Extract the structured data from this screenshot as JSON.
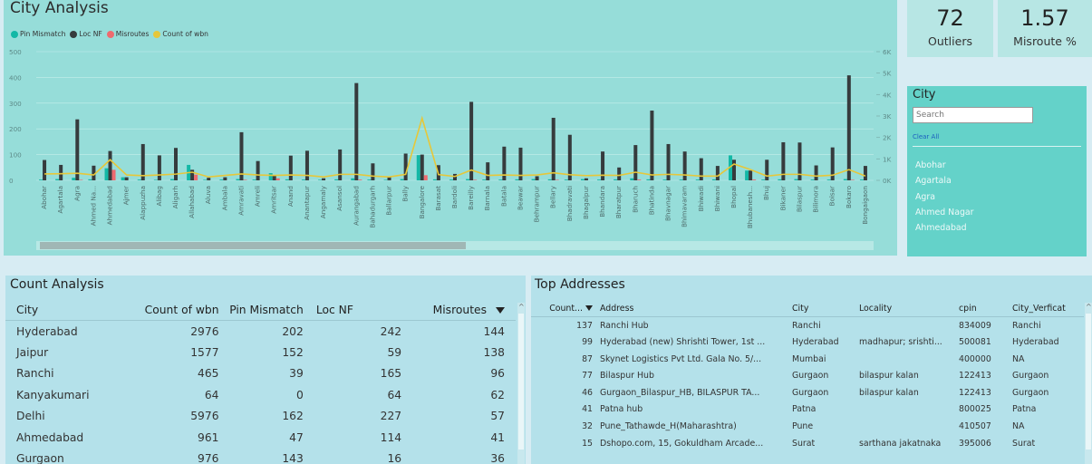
{
  "chart_panel": {
    "title": "City Analysis"
  },
  "kpis": {
    "outliers": {
      "value": "72",
      "label": "Outliers"
    },
    "misroute": {
      "value": "1.57",
      "label": "Misroute %"
    }
  },
  "slicer": {
    "title": "City",
    "search_placeholder": "Search",
    "clear_label": "Clear All",
    "items": [
      "Abohar",
      "Agartala",
      "Agra",
      "Ahmed Nagar",
      "Ahmedabad"
    ]
  },
  "count_analysis": {
    "title": "Count Analysis",
    "columns": [
      "City",
      "Count of wbn",
      "Pin Mismatch",
      "Loc NF",
      "Misroutes"
    ],
    "rows": [
      [
        "Hyderabad",
        "2976",
        "202",
        "242",
        "144"
      ],
      [
        "Jaipur",
        "1577",
        "152",
        "59",
        "138"
      ],
      [
        "Ranchi",
        "465",
        "39",
        "165",
        "96"
      ],
      [
        "Kanyakumari",
        "64",
        "0",
        "64",
        "62"
      ],
      [
        "Delhi",
        "5976",
        "162",
        "227",
        "57"
      ],
      [
        "Ahmedabad",
        "961",
        "47",
        "114",
        "41"
      ],
      [
        "Gurgaon",
        "976",
        "143",
        "16",
        "36"
      ]
    ]
  },
  "top_addresses": {
    "title": "Top Addresses",
    "columns": [
      "Count...",
      "Address",
      "City",
      "Locality",
      "cpin",
      "City_Verficat"
    ],
    "rows": [
      [
        "137",
        "Ranchi Hub",
        "Ranchi",
        "",
        "834009",
        "Ranchi"
      ],
      [
        "99",
        "Hyderabad (new) Shrishti Tower, 1st ...",
        "Hyderabad",
        "madhapur; srishti...",
        "500081",
        "Hyderabad"
      ],
      [
        "87",
        "Skynet Logistics Pvt Ltd. Gala No. 5/...",
        "Mumbai",
        "",
        "400000",
        "NA"
      ],
      [
        "77",
        "Bilaspur Hub",
        "Gurgaon",
        "bilaspur kalan",
        "122413",
        "Gurgaon"
      ],
      [
        "46",
        "Gurgaon_Bilaspur_HB, BILASPUR TA...",
        "Gurgaon",
        "bilaspur kalan",
        "122413",
        "Gurgaon"
      ],
      [
        "41",
        "Patna  hub",
        "Patna",
        "",
        "800025",
        "Patna"
      ],
      [
        "32",
        "Pune_Tathawde_H(Maharashtra)",
        "Pune",
        "",
        "410507",
        "NA"
      ],
      [
        "15",
        "Dshopo.com, 15, Gokuldham Arcade...",
        "Surat",
        "sarthana jakatnaka",
        "395006",
        "Surat"
      ]
    ]
  },
  "colors": {
    "pin_mismatch": "#13b8a6",
    "loc_nf": "#363b3d",
    "misroutes": "#ee6a6f",
    "count_of_wbn": "#e6c73a",
    "chart_bg": "#96ddd9"
  },
  "chart_data": {
    "type": "bar",
    "title": "City Analysis",
    "legend_position": "top-left",
    "y_left": {
      "ticks": [
        "0",
        "100",
        "200",
        "300",
        "400",
        "500"
      ],
      "range": [
        0,
        500
      ]
    },
    "y_right": {
      "ticks": [
        "0K",
        "1K",
        "2K",
        "3K",
        "4K",
        "5K",
        "6K"
      ],
      "range": [
        0,
        6000
      ]
    },
    "categories": [
      "Abohar",
      "Agartala",
      "Agra",
      "Ahmed Na...",
      "Ahmedabad",
      "Ajmer",
      "Alappuzha",
      "Alibag",
      "Aligarh",
      "Allahabad",
      "Aluva",
      "Ambala",
      "Amravati",
      "Amreli",
      "Amritsar",
      "Anand",
      "Anantapur",
      "Angamaly",
      "Asansol",
      "Aurangabad",
      "Bahadurgarh",
      "Ballarpur",
      "Bally",
      "Bangalore",
      "Barasat",
      "Bardoli",
      "Bareilly",
      "Barnala",
      "Batala",
      "Beawar",
      "Behrampur",
      "Bellary",
      "Bhadravati",
      "Bhagalpur",
      "Bhandara",
      "Bharatpur",
      "Bharuch",
      "Bhatinda",
      "Bhavnagar",
      "Bhimavaram",
      "Bhiwadi",
      "Bhiwani",
      "Bhopal",
      "Bhubanesh...",
      "Bhuj",
      "Bikaner",
      "Bilaspur",
      "Bilimora",
      "Boisar",
      "Bokaro",
      "Bongaigaon"
    ],
    "series": [
      {
        "name": "Pin Mismatch",
        "axis": "left",
        "values": [
          3,
          5,
          10,
          4,
          47,
          12,
          3,
          2,
          5,
          60,
          2,
          3,
          5,
          3,
          28,
          4,
          3,
          2,
          4,
          8,
          3,
          2,
          5,
          98,
          4,
          3,
          5,
          3,
          3,
          4,
          5,
          4,
          3,
          5,
          3,
          4,
          8,
          4,
          3,
          3,
          3,
          4,
          97,
          38,
          3,
          4,
          5,
          3,
          3,
          5,
          3
        ]
      },
      {
        "name": "Loc NF",
        "axis": "left",
        "values": [
          79,
          60,
          237,
          57,
          114,
          12,
          141,
          97,
          126,
          41,
          10,
          12,
          187,
          75,
          20,
          96,
          115,
          8,
          120,
          378,
          66,
          12,
          104,
          100,
          59,
          25,
          305,
          70,
          131,
          127,
          16,
          243,
          177,
          8,
          112,
          50,
          137,
          271,
          141,
          112,
          86,
          56,
          80,
          38,
          80,
          148,
          147,
          58,
          128,
          408,
          56
        ]
      },
      {
        "name": "Misroutes",
        "axis": "left",
        "values": [
          0,
          0,
          2,
          0,
          41,
          0,
          0,
          0,
          0,
          22,
          0,
          0,
          2,
          0,
          8,
          0,
          0,
          0,
          0,
          3,
          0,
          0,
          0,
          20,
          0,
          0,
          2,
          0,
          0,
          0,
          0,
          2,
          0,
          0,
          0,
          0,
          3,
          0,
          0,
          0,
          0,
          0,
          0,
          3,
          0,
          0,
          0,
          0,
          0,
          2,
          0
        ]
      },
      {
        "name": "Count of wbn",
        "axis": "right",
        "values": [
          300,
          310,
          330,
          250,
          961,
          250,
          220,
          250,
          290,
          380,
          160,
          230,
          300,
          250,
          230,
          250,
          230,
          160,
          280,
          280,
          200,
          160,
          280,
          2900,
          270,
          180,
          480,
          230,
          250,
          230,
          250,
          350,
          260,
          220,
          240,
          230,
          380,
          250,
          280,
          250,
          200,
          200,
          760,
          500,
          200,
          280,
          280,
          200,
          240,
          500,
          200
        ]
      }
    ]
  }
}
